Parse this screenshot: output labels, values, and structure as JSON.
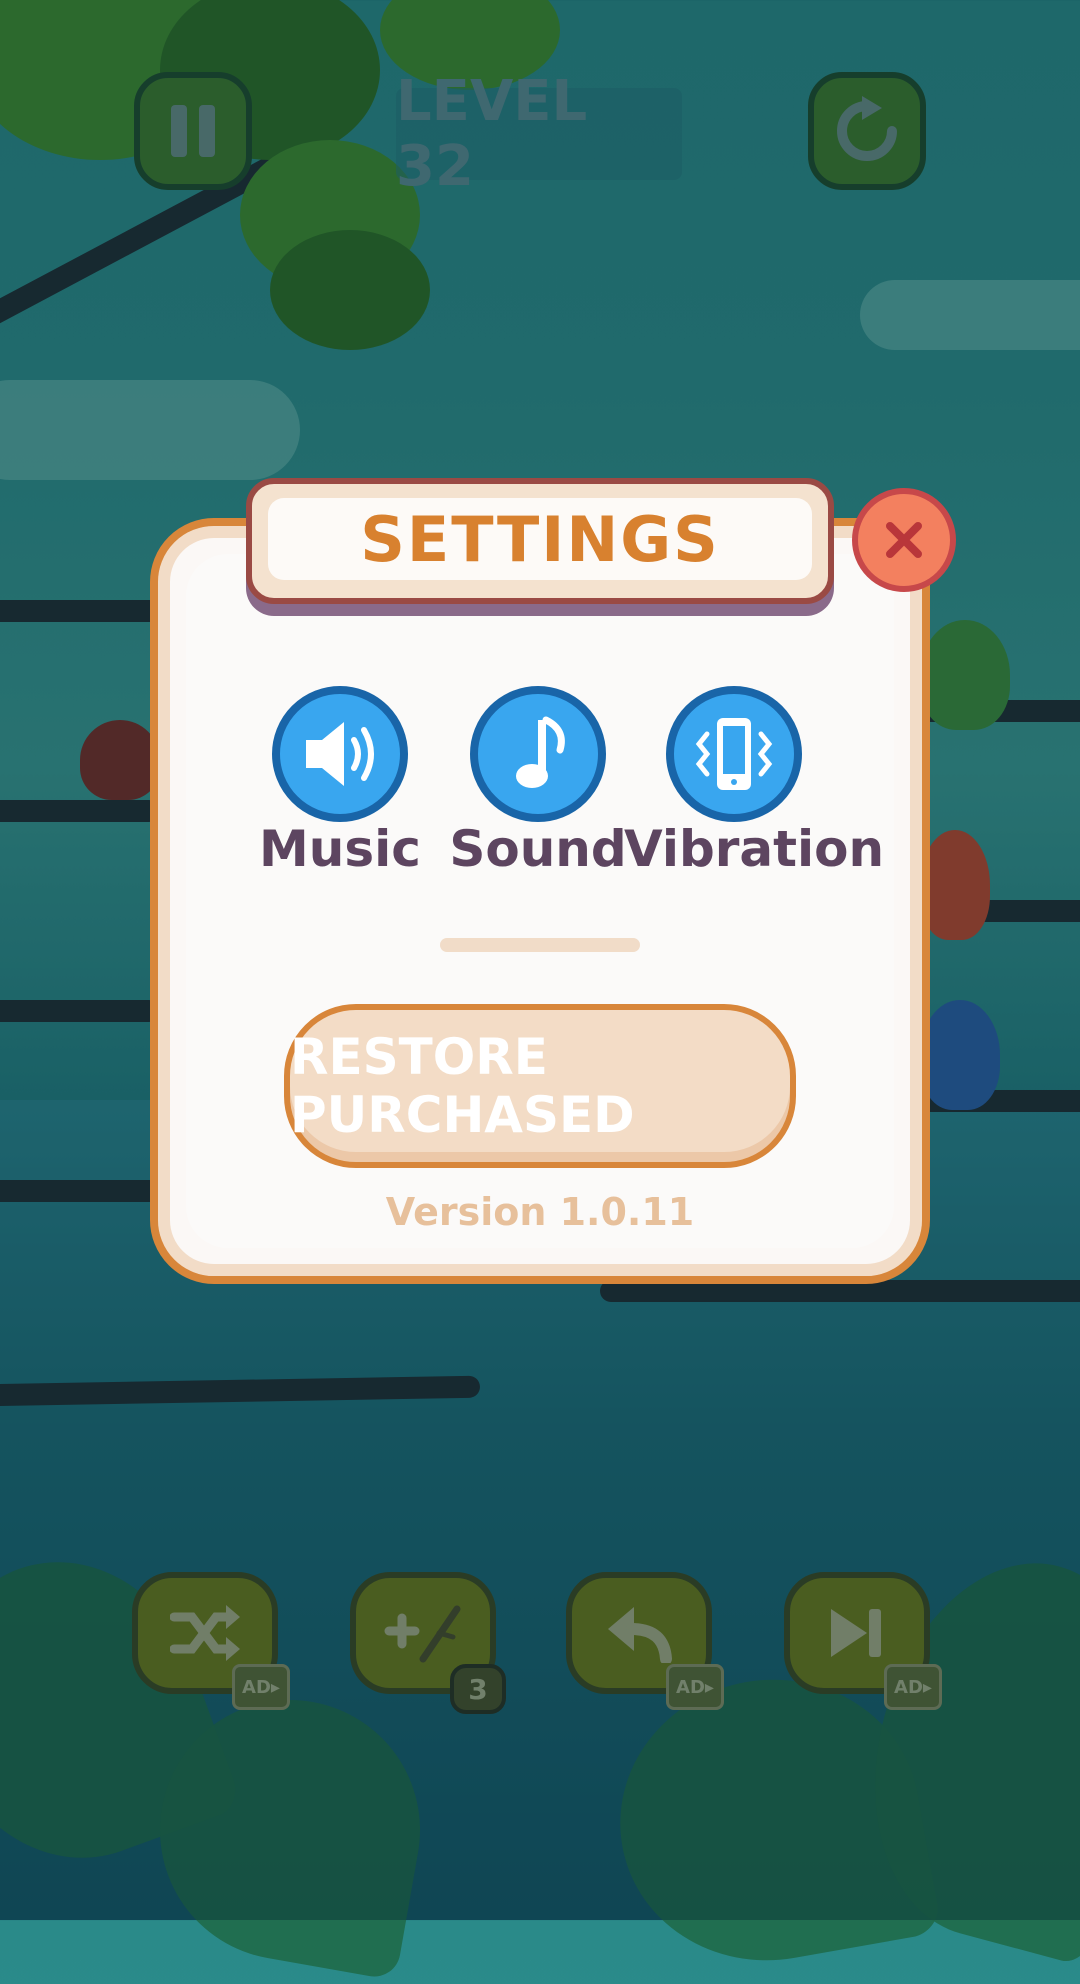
{
  "hud": {
    "level_label": "LEVEL 32",
    "pause_icon": "pause-icon",
    "restart_icon": "restart-icon"
  },
  "settings": {
    "title": "SETTINGS",
    "close_icon": "close-icon",
    "options": [
      {
        "label": "Music",
        "icon": "speaker-icon"
      },
      {
        "label": "Sound",
        "icon": "music-note-icon"
      },
      {
        "label": "Vibration",
        "icon": "phone-vibration-icon"
      }
    ],
    "restore_label": "RESTORE PURCHASED",
    "version": "Version 1.0.11"
  },
  "tools": [
    {
      "name": "shuffle",
      "icon": "shuffle-icon",
      "badge": "AD▸"
    },
    {
      "name": "add-branch",
      "icon": "add-branch-icon",
      "badge": "3"
    },
    {
      "name": "undo",
      "icon": "undo-icon",
      "badge": "AD▸"
    },
    {
      "name": "skip",
      "icon": "skip-icon",
      "badge": "AD▸"
    }
  ],
  "colors": {
    "modal_border": "#d8863a",
    "title_text": "#d8812f",
    "option_blue": "#39a6ef",
    "close_red": "#f3805f"
  }
}
